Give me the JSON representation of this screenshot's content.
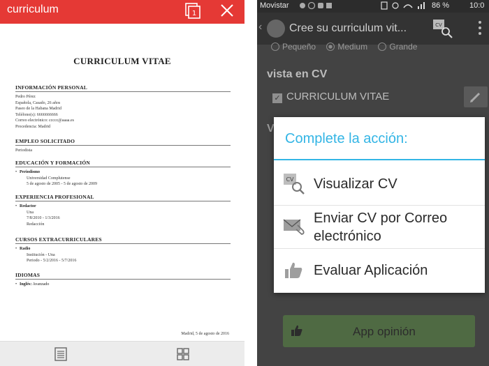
{
  "left_app": {
    "title": "curriculum",
    "page_count_badge": "1",
    "document": {
      "title": "CURRICULUM VITAE",
      "sections": {
        "personal": {
          "heading": "INFORMACIÓN PERSONAL",
          "lines": [
            "Pedro Pérez",
            "Española, Casado, 26 años",
            "Paseo de la Habana Madrid",
            "Teléfono(s): 6666666666",
            "Correo electrónico: ccccc@aaaa.es",
            "Procedencia: Madrid"
          ]
        },
        "job": {
          "heading": "EMPLEO SOLICITADO",
          "lines": [
            "Periodista"
          ]
        },
        "education": {
          "heading": "EDUCACIÓN Y FORMACIÓN",
          "item_title": "Periodismo",
          "item_lines": [
            "Universidad Complutense",
            "5 de agosto de 2005 - 5 de agosto de 2009"
          ]
        },
        "experience": {
          "heading": "EXPERIENCIA PROFESIONAL",
          "item_title": "Redactor",
          "item_lines": [
            "Una",
            "7/8/2010 - 1/3/2016",
            "Redacción"
          ]
        },
        "courses": {
          "heading": "CURSOS EXTRACURRICULARES",
          "item_title": "Radio",
          "item_lines": [
            "Institución - Una",
            "Periodo - 5/2/2016 - 5/7/2016"
          ]
        },
        "languages": {
          "heading": "IDIOMAS",
          "item_title": "Inglés:",
          "item_value": "Avanzado"
        }
      },
      "signature": "Madrid, 5 de agosto de 2016"
    }
  },
  "right_app": {
    "status_bar": {
      "carrier": "Movistar",
      "battery": "86 %",
      "time": "10:0"
    },
    "action_bar": {
      "title": "Cree su curriculum vit..."
    },
    "background": {
      "radio_options": [
        "Pequeño",
        "Medium",
        "Grande"
      ],
      "selected_radio": "Medium",
      "section_title": "vista en CV",
      "checkbox_label": "CURRICULUM VITAE",
      "checkbox_checked": true,
      "opinion_button": "App opinión"
    },
    "dialog": {
      "title": "Complete la acción:",
      "items": [
        {
          "label": "Visualizar CV",
          "icon": "cv-search-icon"
        },
        {
          "label_line1": "Enviar CV por Correo",
          "label_line2": "electrónico",
          "icon": "mail-paperclip-icon"
        },
        {
          "label": "Evaluar Aplicación",
          "icon": "thumbs-up-icon"
        }
      ]
    }
  },
  "colors": {
    "left_topbar": "#e53935",
    "dialog_accent": "#33b5e5",
    "opinion_button": "#4f6a43"
  }
}
